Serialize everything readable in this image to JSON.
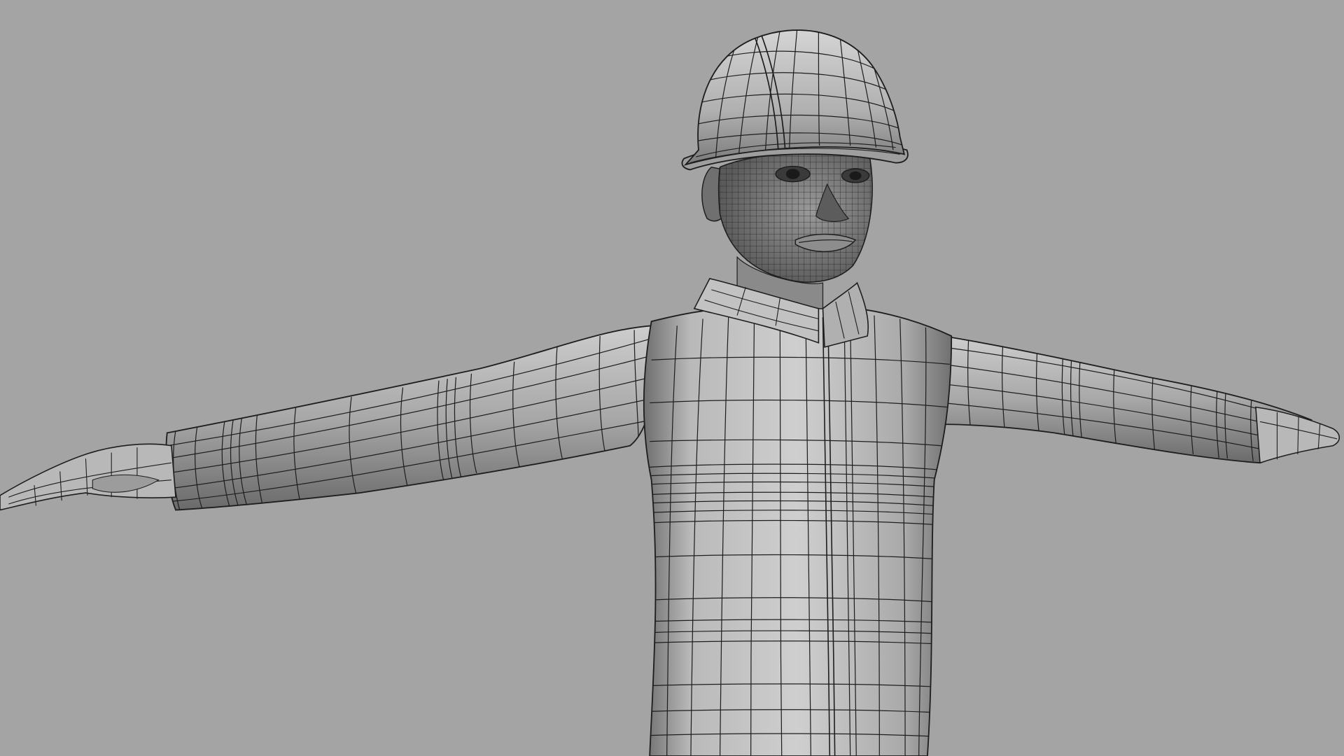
{
  "viewport": {
    "background": "#a4a4a4",
    "subject": "construction-worker-model",
    "display_mode": "wireframe-on-shaded",
    "pose": "t-pose"
  },
  "colors": {
    "surface_light": "#cfcfcf",
    "surface_mid": "#adadad",
    "surface_dark": "#6e6e6e",
    "wire": "#1e1e1e"
  },
  "icons": [
    "hard-hat-icon"
  ]
}
